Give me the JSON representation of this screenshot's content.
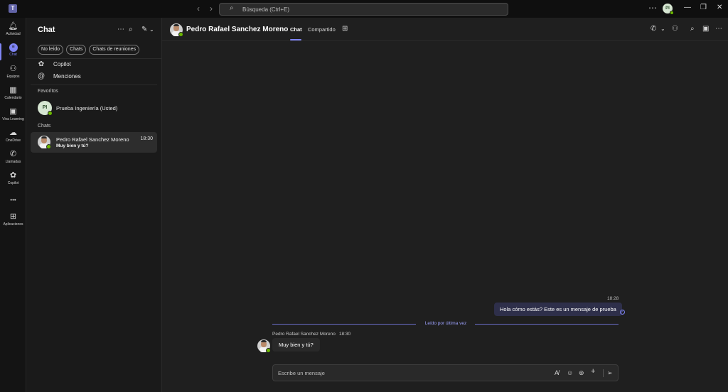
{
  "titlebar": {
    "search_placeholder": "Búsqueda (Ctrl+E)",
    "avatar_initials": "PI",
    "more_glyph": "⋯",
    "minimize_glyph": "—",
    "restore_glyph": "❐",
    "close_glyph": "✕",
    "back_glyph": "‹",
    "forward_glyph": "›",
    "search_glyph": "⌕"
  },
  "rail": {
    "items": [
      {
        "label": "Actividad",
        "icon": "bell-icon",
        "glyph": "🔔︎"
      },
      {
        "label": "Chat",
        "icon": "chat-icon",
        "glyph": "≡"
      },
      {
        "label": "Equipos",
        "icon": "teams-icon",
        "glyph": "⚇"
      },
      {
        "label": "Calendario",
        "icon": "calendar-icon",
        "glyph": "▦"
      },
      {
        "label": "Viva Learning",
        "icon": "learning-icon",
        "glyph": "▣"
      },
      {
        "label": "OneDrive",
        "icon": "cloud-icon",
        "glyph": "☁"
      },
      {
        "label": "Llamadas",
        "icon": "phone-icon",
        "glyph": "✆"
      },
      {
        "label": "Copilot",
        "icon": "copilot-icon",
        "glyph": "✿"
      },
      {
        "label": "Aplicaciones",
        "icon": "apps-icon",
        "glyph": "⊞"
      }
    ],
    "more_glyph": "•••"
  },
  "sidebar": {
    "title": "Chat",
    "more_glyph": "⋯",
    "search_glyph": "⌕",
    "compose_glyph": "✎",
    "chevron_glyph": "⌄",
    "filters": [
      "No leído",
      "Chats",
      "Chats de reuniones"
    ],
    "copilot_label": "Copilot",
    "copilot_glyph": "✿",
    "mentions_label": "Menciones",
    "mentions_glyph": "@",
    "favorites_title": "Favoritos",
    "favorite_initials": "PI",
    "favorite_name": "Prueba Ingeniería (Usted)",
    "chats_title": "Chats",
    "chat_item": {
      "name": "Pedro Rafael Sanchez Moreno",
      "time": "18:30",
      "preview": "Muy bien y tú?"
    }
  },
  "header": {
    "contact_name": "Pedro Rafael Sanchez Moreno",
    "tabs": [
      "Chat",
      "Compartido"
    ],
    "add_tab_glyph": "⊞",
    "call_glyph": "✆",
    "call_chevron_glyph": "⌄",
    "people_glyph": "⚇",
    "search_glyph": "⌕",
    "side_panel_glyph": "▣",
    "more_glyph": "⋯"
  },
  "conversation": {
    "outgoing_time": "18:28",
    "outgoing_text": "Hola cómo estás? Este es un mensaje de prueba",
    "read_glyph": "✓",
    "last_read_label": "Leído por última vez",
    "incoming_sender": "Pedro Rafael Sanchez Moreno",
    "incoming_time": "18:30",
    "incoming_text": "Muy bien y tú?"
  },
  "composer": {
    "placeholder": "Escribe un mensaje",
    "format_glyph": "A̸",
    "emoji_glyph": "☺",
    "loop_glyph": "⊛",
    "attach_glyph": "+",
    "send_glyph": "➢"
  },
  "colors": {
    "accent": "#7f85f5",
    "presence_available": "#6bb700",
    "outgoing_bubble": "#2e2f4a",
    "background": "#1f1f1f"
  }
}
